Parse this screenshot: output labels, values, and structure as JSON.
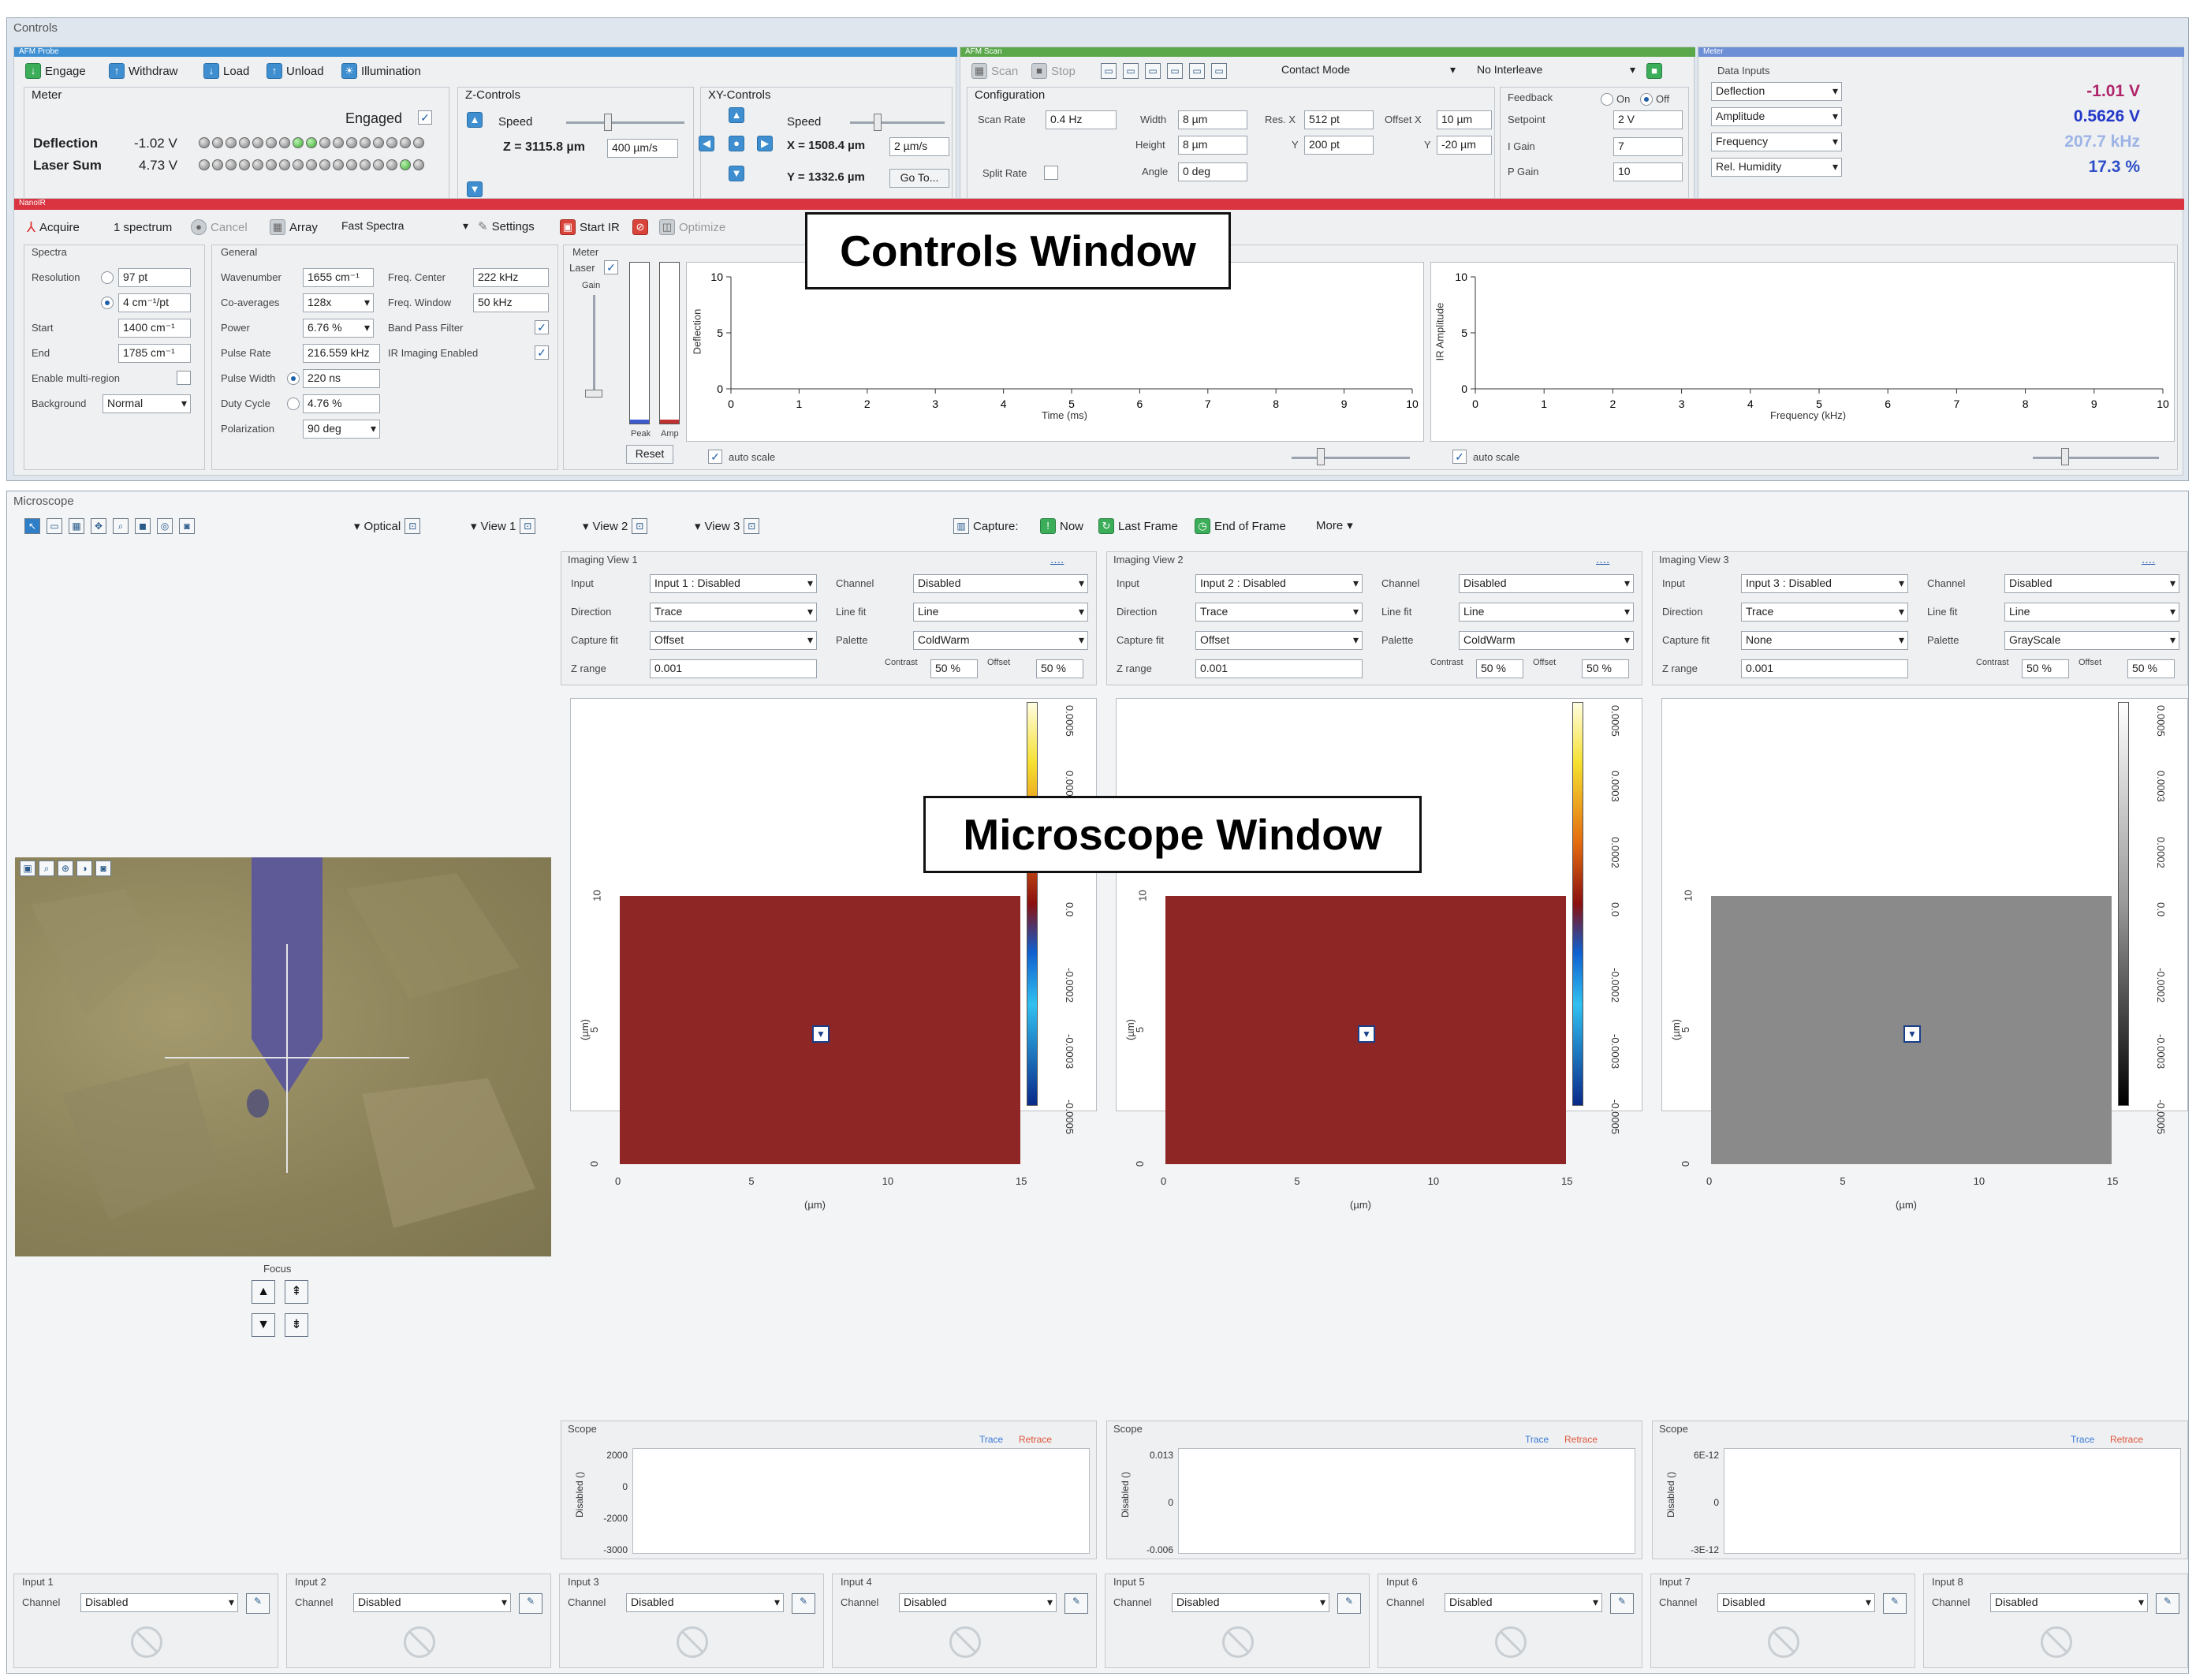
{
  "controls": {
    "title": "Controls",
    "callout": "Controls Window",
    "afm_probe": {
      "header": "AFM Probe",
      "buttons": [
        "Engage",
        "Withdraw",
        "Load",
        "Unload",
        "Illumination"
      ],
      "meter_label": "Meter",
      "engaged_label": "Engaged",
      "deflection_label": "Deflection",
      "deflection_value": "-1.02 V",
      "laser_sum_label": "Laser Sum",
      "laser_sum_value": "4.73 V",
      "z_controls_label": "Z-Controls",
      "z_speed_label": "Speed",
      "z_value": "Z = 3115.8 µm",
      "z_speed_value": "400 µm/s",
      "xy_controls_label": "XY-Controls",
      "xy_speed_label": "Speed",
      "x_value": "X = 1508.4 µm",
      "xy_speed_value": "2 µm/s",
      "y_value": "Y = 1332.6 µm",
      "goto_label": "Go To..."
    },
    "afm_scan": {
      "header": "AFM Scan",
      "scan_label": "Scan",
      "stop_label": "Stop",
      "mode": "Contact Mode",
      "interleave": "No Interleave",
      "configuration_label": "Configuration",
      "scan_rate_label": "Scan Rate",
      "scan_rate_value": "0.4 Hz",
      "width_label": "Width",
      "width_value": "8 µm",
      "height_label": "Height",
      "height_value": "8 µm",
      "angle_label": "Angle",
      "angle_value": "0 deg",
      "res_label": "Res. X",
      "res_x_value": "512 pt",
      "res_y_label": "Y",
      "res_y_value": "200 pt",
      "offset_label": "Offset X",
      "offset_x_value": "10 µm",
      "offset_y_label": "Y",
      "offset_y_value": "-20 µm",
      "split_rate_label": "Split Rate",
      "feedback_label": "Feedback",
      "on_label": "On",
      "off_label": "Off",
      "setpoint_label": "Setpoint",
      "setpoint_value": "2 V",
      "igain_label": "I Gain",
      "igain_value": "7",
      "pgain_label": "P Gain",
      "pgain_value": "10"
    },
    "meter": {
      "header": "Meter",
      "data_inputs_label": "Data Inputs",
      "rows": [
        {
          "name": "Deflection",
          "value": "-1.01 V",
          "color": "#b0246a"
        },
        {
          "name": "Amplitude",
          "value": "0.5626 V",
          "color": "#2438c8"
        },
        {
          "name": "Frequency",
          "value": "207.7 kHz",
          "color": "#9db4e6"
        },
        {
          "name": "Rel. Humidity",
          "value": "17.3 %",
          "color": "#2f4fc8"
        }
      ]
    },
    "nanoir": {
      "header": "NanoIR",
      "acquire_label": "Acquire",
      "spectrum_label": "1 spectrum",
      "cancel_label": "Cancel",
      "array_label": "Array",
      "mode_value": "Fast Spectra",
      "settings_label": "Settings",
      "start_ir_label": "Start IR",
      "optimize_label": "Optimize",
      "spectra_label": "Spectra",
      "resolution_label": "Resolution",
      "resolution_value1": "97 pt",
      "resolution_value2": "4 cm⁻¹/pt",
      "start_label": "Start",
      "start_value": "1400 cm⁻¹",
      "end_label": "End",
      "end_value": "1785 cm⁻¹",
      "multi_region_label": "Enable multi-region",
      "background_label": "Background",
      "background_value": "Normal",
      "general_label": "General",
      "wavenumber_label": "Wavenumber",
      "wavenumber_value": "1655 cm⁻¹",
      "coaverages_label": "Co-averages",
      "coaverages_value": "128x",
      "power_label": "Power",
      "power_value": "6.76 %",
      "pulse_rate_label": "Pulse Rate",
      "pulse_rate_value": "216.559 kHz",
      "pulse_width_label": "Pulse Width",
      "pulse_width_value": "220 ns",
      "duty_cycle_label": "Duty Cycle",
      "duty_cycle_value": "4.76 %",
      "polarization_label": "Polarization",
      "polarization_value": "90 deg",
      "freq_center_label": "Freq. Center",
      "freq_center_value": "222 kHz",
      "freq_window_label": "Freq. Window",
      "freq_window_value": "50 kHz",
      "band_pass_label": "Band Pass Filter",
      "ir_imaging_label": "IR Imaging Enabled",
      "meter_label": "Meter",
      "laser_label": "Laser",
      "gain_label": "Gain",
      "peak_label": "Peak",
      "amp_label": "Amp",
      "reset_label": "Reset",
      "deflection_plot": {
        "ylabel": "Deflection",
        "xlabel": "Time (ms)",
        "yticks": [
          "10",
          "5",
          "0"
        ],
        "xticks": [
          "0",
          "1",
          "2",
          "3",
          "4",
          "5",
          "6",
          "7",
          "8",
          "9",
          "10"
        ],
        "autoscale_label": "auto scale"
      },
      "ir_plot": {
        "ylabel": "IR Amplitude",
        "xlabel": "Frequency (kHz)",
        "yticks": [
          "10",
          "5",
          "0"
        ],
        "xticks": [
          "0",
          "1",
          "2",
          "3",
          "4",
          "5",
          "6",
          "7",
          "8",
          "9",
          "10"
        ],
        "autoscale_label": "auto scale"
      }
    }
  },
  "microscope": {
    "title": "Microscope",
    "callout": "Microscope Window",
    "tabs": [
      "Optical",
      "View 1",
      "View 2",
      "View 3"
    ],
    "capture_label": "Capture:",
    "now_label": "Now",
    "last_frame_label": "Last Frame",
    "end_of_frame_label": "End of Frame",
    "more_label": "More",
    "focus_label": "Focus",
    "views": [
      {
        "title": "Imaging View 1",
        "input_label": "Input",
        "input_value": "Input 1 : Disabled",
        "channel_label": "Channel",
        "channel_value": "Disabled",
        "direction_label": "Direction",
        "direction_value": "Trace",
        "linefit_label": "Line fit",
        "linefit_value": "Line",
        "capturefit_label": "Capture fit",
        "capturefit_value": "Offset",
        "palette_label": "Palette",
        "palette_value": "ColdWarm",
        "zrange_label": "Z range",
        "zrange_value": "0.001",
        "contrast_label": "Contrast",
        "contrast_value": "50 %",
        "offset_label": "Offset",
        "offset_value": "50 %",
        "image_color": "#8e2626",
        "colorbar": "coldwarm",
        "cbar_ticks": [
          "0.0005",
          "0.0003",
          "0.0002",
          "0.0",
          "-0.0002",
          "-0.0003",
          "-0.0005"
        ],
        "yticks": [
          "10",
          "5",
          "0"
        ],
        "xticks": [
          "0",
          "5",
          "10",
          "15"
        ],
        "axis_unit": "(µm)",
        "scope_label": "Scope",
        "trace_label": "Trace",
        "retrace_label": "Retrace",
        "scope_ylabel": "Disabled ()",
        "scope_ticks": [
          "2000",
          "0",
          "-2000",
          "-3000"
        ]
      },
      {
        "title": "Imaging View 2",
        "input_label": "Input",
        "input_value": "Input 2 : Disabled",
        "channel_label": "Channel",
        "channel_value": "Disabled",
        "direction_label": "Direction",
        "direction_value": "Trace",
        "linefit_label": "Line fit",
        "linefit_value": "Line",
        "capturefit_label": "Capture fit",
        "capturefit_value": "Offset",
        "palette_label": "Palette",
        "palette_value": "ColdWarm",
        "zrange_label": "Z range",
        "zrange_value": "0.001",
        "contrast_label": "Contrast",
        "contrast_value": "50 %",
        "offset_label": "Offset",
        "offset_value": "50 %",
        "image_color": "#8e2626",
        "colorbar": "coldwarm",
        "cbar_ticks": [
          "0.0005",
          "0.0003",
          "0.0002",
          "0.0",
          "-0.0002",
          "-0.0003",
          "-0.0005"
        ],
        "yticks": [
          "10",
          "5",
          "0"
        ],
        "xticks": [
          "0",
          "5",
          "10",
          "15"
        ],
        "axis_unit": "(µm)",
        "scope_label": "Scope",
        "trace_label": "Trace",
        "retrace_label": "Retrace",
        "scope_ylabel": "Disabled ()",
        "scope_ticks": [
          "0.013",
          "0",
          "-0.006"
        ]
      },
      {
        "title": "Imaging View 3",
        "input_label": "Input",
        "input_value": "Input 3 : Disabled",
        "channel_label": "Channel",
        "channel_value": "Disabled",
        "direction_label": "Direction",
        "direction_value": "Trace",
        "linefit_label": "Line fit",
        "linefit_value": "Line",
        "capturefit_label": "Capture fit",
        "capturefit_value": "None",
        "palette_label": "Palette",
        "palette_value": "GrayScale",
        "zrange_label": "Z range",
        "zrange_value": "0.001",
        "contrast_label": "Contrast",
        "contrast_value": "50 %",
        "offset_label": "Offset",
        "offset_value": "50 %",
        "image_color": "#8a8a8a",
        "colorbar": "gray",
        "cbar_ticks": [
          "0.0005",
          "0.0003",
          "0.0002",
          "0.0",
          "-0.0002",
          "-0.0003",
          "-0.0005"
        ],
        "yticks": [
          "10",
          "5",
          "0"
        ],
        "xticks": [
          "0",
          "5",
          "10",
          "15"
        ],
        "axis_unit": "(µm)",
        "scope_label": "Scope",
        "trace_label": "Trace",
        "retrace_label": "Retrace",
        "scope_ylabel": "Disabled ()",
        "scope_ticks": [
          "6E-12",
          "0",
          "-3E-12"
        ]
      }
    ],
    "inputs": [
      {
        "title": "Input 1",
        "channel_label": "Channel",
        "channel_value": "Disabled"
      },
      {
        "title": "Input 2",
        "channel_label": "Channel",
        "channel_value": "Disabled"
      },
      {
        "title": "Input 3",
        "channel_label": "Channel",
        "channel_value": "Disabled"
      },
      {
        "title": "Input 4",
        "channel_label": "Channel",
        "channel_value": "Disabled"
      },
      {
        "title": "Input 5",
        "channel_label": "Channel",
        "channel_value": "Disabled"
      },
      {
        "title": "Input 6",
        "channel_label": "Channel",
        "channel_value": "Disabled"
      },
      {
        "title": "Input 7",
        "channel_label": "Channel",
        "channel_value": "Disabled"
      },
      {
        "title": "Input 8",
        "channel_label": "Channel",
        "channel_value": "Disabled"
      }
    ]
  }
}
